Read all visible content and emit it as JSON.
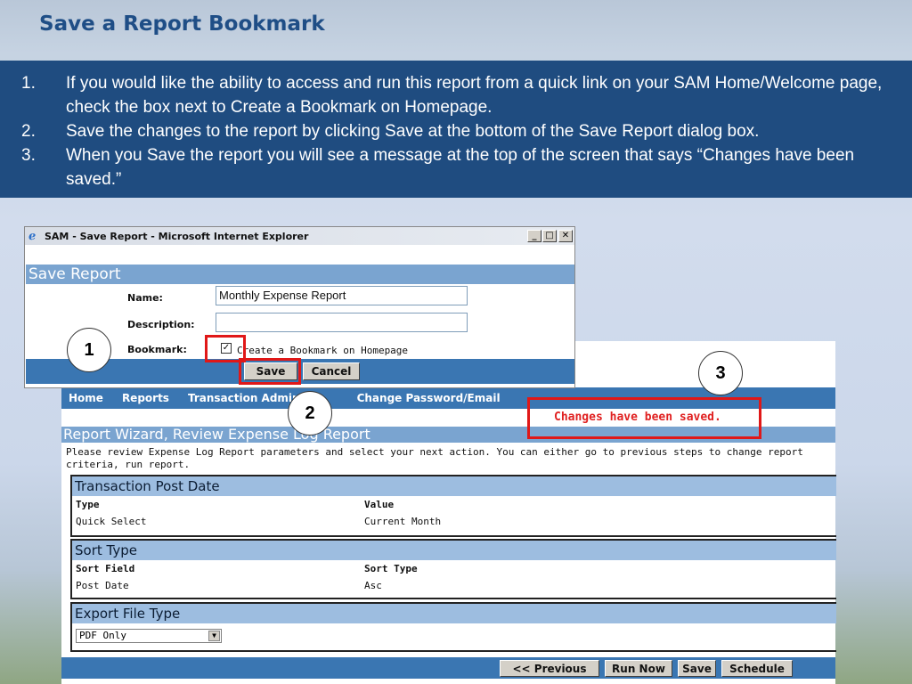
{
  "slide": {
    "title": "Save a Report Bookmark",
    "steps": [
      {
        "num": "1.",
        "text": "If you would like the ability to access and run this report from a quick link on your SAM Home/Welcome page, check the box next to Create a Bookmark on Homepage."
      },
      {
        "num": "2.",
        "text": "Save the changes to the report by clicking Save at the bottom of the Save Report dialog box."
      },
      {
        "num": "3.",
        "text": "When you Save the report you will see a message at the top of the screen that says “Changes have been saved.”"
      }
    ]
  },
  "save_dialog": {
    "window_title": "SAM - Save Report - Microsoft Internet Explorer",
    "window_buttons": {
      "minimize": "_",
      "maximize": "□",
      "close": "✕"
    },
    "heading": "Save Report",
    "name_label": "Name:",
    "name_value": "Monthly Expense Report",
    "description_label": "Description:",
    "description_value": "",
    "bookmark_label": "Bookmark:",
    "bookmark_checked": true,
    "bookmark_text": "Create a Bookmark on Homepage",
    "save_button": "Save",
    "cancel_button": "Cancel"
  },
  "wizard": {
    "nav": [
      "Home",
      "Reports",
      "Transaction Administ",
      "Change Password/Email"
    ],
    "saved_message": "Changes have been saved.",
    "title": "Report Wizard, Review Expense Log Report",
    "description": "Please review Expense Log Report parameters and select your next action. You can either go to previous steps to change report criteria, run report.",
    "sections": {
      "post_date": {
        "title": "Transaction Post Date",
        "col1_header": "Type",
        "col2_header": "Value",
        "col1_value": "Quick Select",
        "col2_value": "Current Month"
      },
      "sort": {
        "title": "Sort Type",
        "col1_header": "Sort Field",
        "col2_header": "Sort Type",
        "col1_value": "Post Date",
        "col2_value": "Asc"
      },
      "export": {
        "title": "Export File Type",
        "selected": "PDF Only"
      }
    },
    "buttons": {
      "previous": "<< Previous",
      "run_now": "Run Now",
      "save": "Save",
      "schedule": "Schedule"
    }
  },
  "callouts": {
    "one": "1",
    "two": "2",
    "three": "3"
  },
  "colors": {
    "callout_red": "#e01818",
    "header_blue": "#1f4c80",
    "section_blue": "#9dbde0",
    "bar_blue": "#3a76b2"
  }
}
